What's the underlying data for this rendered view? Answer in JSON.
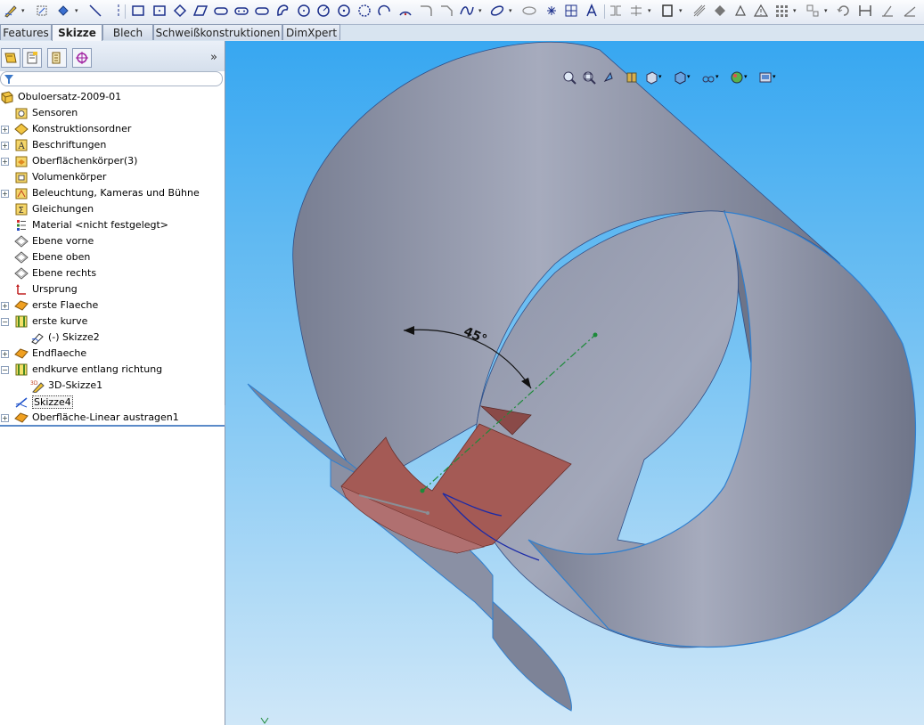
{
  "toolbar": {
    "icons": [
      "sketch-icon",
      "rotate-icon",
      "smart-dimension-icon",
      "line-icon",
      "rectangle-icon",
      "center-rectangle-icon",
      "diamond-icon",
      "parallelogram-icon",
      "slot-icon",
      "straight-slot-icon",
      "arc-slot-icon",
      "circle-icon",
      "perimeter-circle-icon",
      "tangent-arc-icon",
      "three-point-arc-icon",
      "centerpoint-arc-icon",
      "fillet-icon",
      "spline-icon",
      "ellipse-icon",
      "partial-ellipse-icon",
      "point-icon",
      "text-icon",
      "trim-icon",
      "convert-entities-icon",
      "offset-icon",
      "mirror-icon",
      "warning-icon",
      "grid-icon",
      "display-relations-icon",
      "repair-icon",
      "move-icon",
      "quick-snaps-icon"
    ]
  },
  "tabs": [
    "Features",
    "Skizze",
    "Blech",
    "Schweißkonstruktionen",
    "DimXpert"
  ],
  "active_tab": "Skizze",
  "panel": {
    "tab_icons": [
      "feature-manager-icon",
      "property-manager-icon",
      "configuration-manager-icon",
      "dimxpert-manager-icon"
    ],
    "more": "»",
    "tree": [
      {
        "label": "Obuloersatz-2009-01",
        "indent": 0,
        "expand": "",
        "icon": "part"
      },
      {
        "label": "Sensoren",
        "indent": 1,
        "expand": "",
        "icon": "sensor"
      },
      {
        "label": "Konstruktionsordner",
        "indent": 1,
        "expand": "+",
        "icon": "folder"
      },
      {
        "label": "Beschriftungen",
        "indent": 1,
        "expand": "+",
        "icon": "annotation"
      },
      {
        "label": "Oberflächenkörper(3)",
        "indent": 1,
        "expand": "+",
        "icon": "surface-folder"
      },
      {
        "label": "Volumenkörper",
        "indent": 1,
        "expand": "",
        "icon": "solid-folder"
      },
      {
        "label": "Beleuchtung, Kameras und Bühne",
        "indent": 1,
        "expand": "+",
        "icon": "lights"
      },
      {
        "label": "Gleichungen",
        "indent": 1,
        "expand": "",
        "icon": "equations"
      },
      {
        "label": "Material <nicht festgelegt>",
        "indent": 1,
        "expand": "",
        "icon": "material"
      },
      {
        "label": "Ebene vorne",
        "indent": 1,
        "expand": "",
        "icon": "plane"
      },
      {
        "label": "Ebene oben",
        "indent": 1,
        "expand": "",
        "icon": "plane"
      },
      {
        "label": "Ebene rechts",
        "indent": 1,
        "expand": "",
        "icon": "plane"
      },
      {
        "label": "Ursprung",
        "indent": 1,
        "expand": "",
        "icon": "origin"
      },
      {
        "label": "erste Flaeche",
        "indent": 1,
        "expand": "+",
        "icon": "surface"
      },
      {
        "label": "erste kurve",
        "indent": 1,
        "expand": "−",
        "icon": "curve"
      },
      {
        "label": "(-) Skizze2",
        "indent": 2,
        "expand": "",
        "icon": "sketch"
      },
      {
        "label": "Endflaeche",
        "indent": 1,
        "expand": "+",
        "icon": "surface"
      },
      {
        "label": "endkurve entlang richtung",
        "indent": 1,
        "expand": "−",
        "icon": "curve"
      },
      {
        "label": "3D-Skizze1",
        "indent": 2,
        "expand": "",
        "icon": "3dsketch"
      },
      {
        "label": "Skizze4",
        "indent": 1,
        "expand": "",
        "icon": "sketch-blue",
        "selected": true
      },
      {
        "label": "Oberfläche-Linear austragen1",
        "indent": 1,
        "expand": "+",
        "icon": "surface"
      }
    ]
  },
  "viewport": {
    "view_tools": [
      "zoom-to-fit-icon",
      "zoom-area-icon",
      "previous-view-icon",
      "section-view-icon",
      "view-orientation-icon",
      "display-style-icon",
      "hide-show-icon",
      "appearance-icon",
      "scene-icon"
    ],
    "dimension_label": "45°",
    "colors": {
      "surface": "#8a90a4",
      "surface_dark": "#6b7186",
      "red_surface": "#a0524f",
      "edge": "#2f7fcf"
    }
  }
}
